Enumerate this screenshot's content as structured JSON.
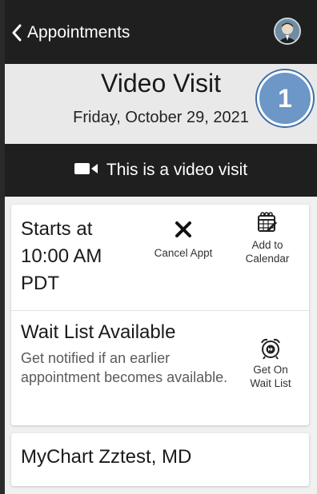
{
  "header": {
    "back_label": "Appointments",
    "back_icon": "chevron-left-icon",
    "avatar_icon": "user-avatar"
  },
  "visit": {
    "title": "Video Visit",
    "date": "Friday, October 29, 2021"
  },
  "callout": {
    "number": "1",
    "color": "#6c97c7"
  },
  "banner": {
    "icon": "video-camera-icon",
    "text": "This is a video visit"
  },
  "appointment": {
    "starts_line1": "Starts at",
    "starts_line2": "10:00 AM",
    "starts_line3": "PDT",
    "cancel": {
      "icon": "x-icon",
      "label": "Cancel Appt"
    },
    "add_calendar": {
      "icon": "calendar-add-icon",
      "label_line1": "Add to",
      "label_line2": "Calendar"
    }
  },
  "waitlist": {
    "title": "Wait List Available",
    "description": "Get notified if an earlier appointment becomes available.",
    "action": {
      "icon": "alarm-clock-icon",
      "label_line1": "Get On",
      "label_line2": "Wait List"
    }
  },
  "provider": {
    "name": "MyChart Zztest, MD"
  },
  "colors": {
    "header_bg": "#1f1f1f",
    "visit_bg": "#e9e9e9",
    "page_bg": "#f0f0f0",
    "card_bg": "#ffffff",
    "secondary_text": "#5a5a5a"
  }
}
